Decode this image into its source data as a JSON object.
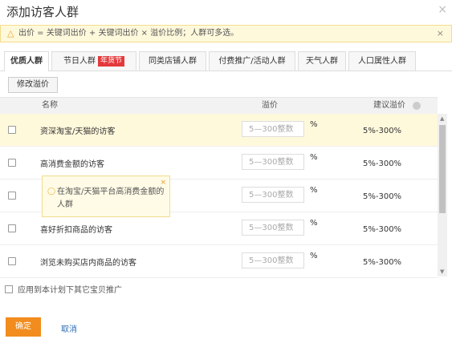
{
  "dialog": {
    "title": "添加访客人群",
    "close_icon": "close-icon"
  },
  "notice": {
    "warn_icon": "warning-triangle-icon",
    "text": "出价 = 关键词出价 + 关键词出价 × 溢价比例；人群可多选。",
    "close": "×"
  },
  "tabs": [
    {
      "label": "优质人群",
      "active": true
    },
    {
      "label": "节日人群",
      "badge": "年货节"
    },
    {
      "label": "同类店铺人群"
    },
    {
      "label": "付费推广/活动人群"
    },
    {
      "label": "天气人群"
    },
    {
      "label": "人口属性人群"
    }
  ],
  "toolbar": {
    "modify_premium": "修改溢价"
  },
  "table": {
    "headers": {
      "name": "名称",
      "premium": "溢价",
      "suggested": "建议溢价"
    },
    "rows": [
      {
        "name": "资深淘宝/天猫的访客",
        "placeholder": "5—300整数",
        "unit": "%",
        "suggested": "5%-300%",
        "highlight": true
      },
      {
        "name": "高消费金额的访客",
        "placeholder": "5—300整数",
        "unit": "%",
        "suggested": "5%-300%"
      },
      {
        "name": "",
        "placeholder": "5—300整数",
        "unit": "%",
        "suggested": "5%-300%"
      },
      {
        "name": "喜好折扣商品的访客",
        "placeholder": "5—300整数",
        "unit": "%",
        "suggested": "5%-300%"
      },
      {
        "name": "浏览未购买店内商品的访客",
        "placeholder": "5—300整数",
        "unit": "%",
        "suggested": "5%-300%"
      }
    ]
  },
  "tooltip": {
    "text": "在淘宝/天猫平台高消费金额的人群",
    "close": "×"
  },
  "apply_all": {
    "label": "应用到本计划下其它宝贝推广"
  },
  "footer": {
    "ok": "确定",
    "cancel": "取消"
  },
  "colors": {
    "accent": "#f28c1f",
    "badge": "#e4393c",
    "link": "#2b6cb6",
    "highlight": "#fff9dc"
  }
}
